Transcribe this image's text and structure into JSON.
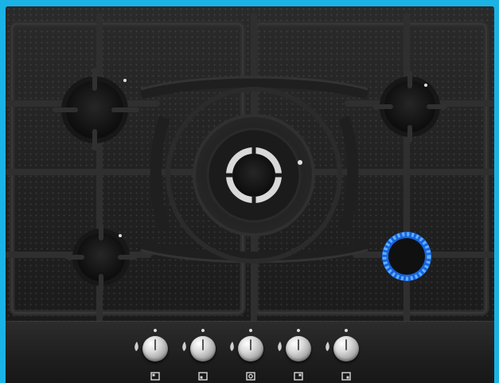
{
  "hob": {
    "colors": {
      "background": "#1ab3e6",
      "glass": "#1f1f1f",
      "grate": "#2b2b2b",
      "burner_cap": "#151515",
      "flame": "#2f7bff"
    },
    "burners": [
      {
        "id": "front-left",
        "lit": false
      },
      {
        "id": "rear-left",
        "lit": false
      },
      {
        "id": "center-wok",
        "lit": false
      },
      {
        "id": "rear-right",
        "lit": false
      },
      {
        "id": "front-right",
        "lit": true
      }
    ],
    "knobs": [
      {
        "position_icon": "rear-left-indicator-icon"
      },
      {
        "position_icon": "front-left-indicator-icon"
      },
      {
        "position_icon": "center-indicator-icon"
      },
      {
        "position_icon": "rear-right-indicator-icon"
      },
      {
        "position_icon": "front-right-indicator-icon"
      }
    ]
  }
}
